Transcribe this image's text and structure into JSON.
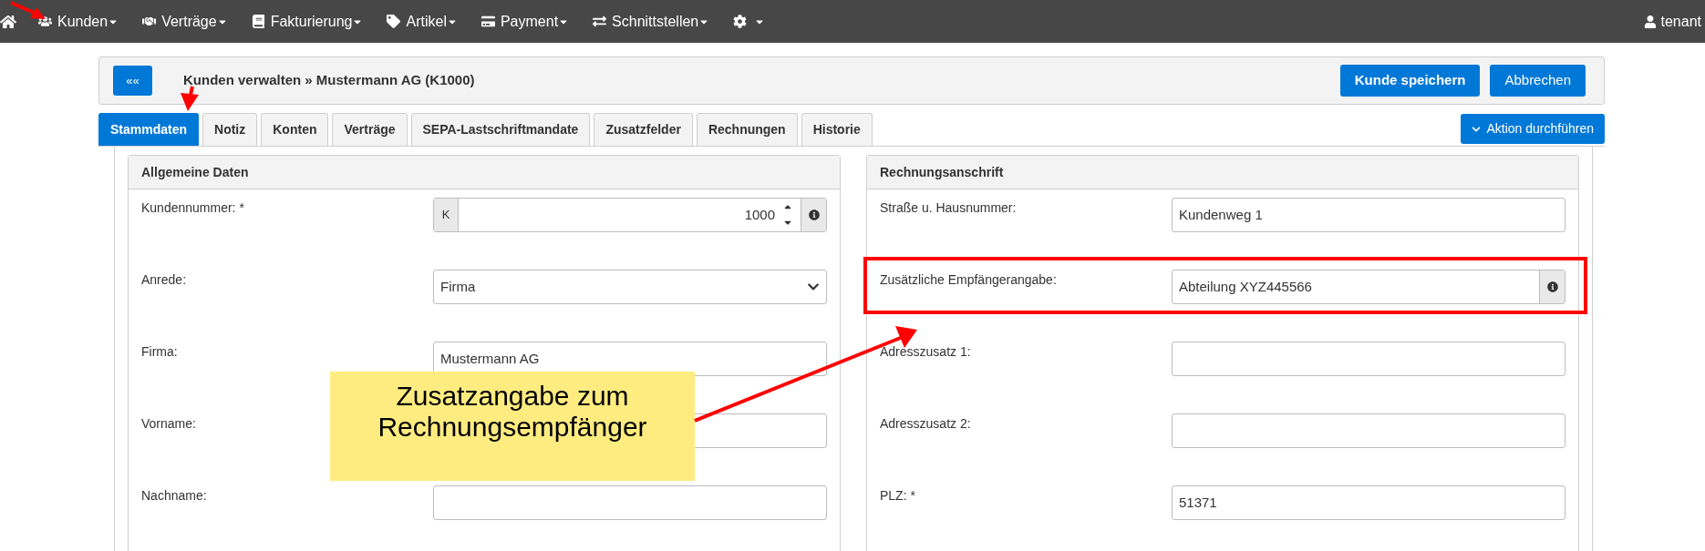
{
  "nav": {
    "items": [
      {
        "label": "Kunden"
      },
      {
        "label": "Verträge"
      },
      {
        "label": "Fakturierung"
      },
      {
        "label": "Artikel"
      },
      {
        "label": "Payment"
      },
      {
        "label": "Schnittstellen"
      }
    ],
    "user": "tenant"
  },
  "header": {
    "back": "««",
    "title": "Kunden verwalten » Mustermann AG (K1000)",
    "buttons": [
      {
        "label": "Kunde speichern",
        "primary": true
      },
      {
        "label": "Abbrechen",
        "primary": false
      }
    ]
  },
  "tabs": [
    {
      "label": "Stammdaten",
      "selected": true
    },
    {
      "label": "Notiz",
      "selected": false
    },
    {
      "label": "Konten",
      "selected": false
    },
    {
      "label": "Verträge",
      "selected": false
    },
    {
      "label": "SEPA-Lastschriftmandate",
      "selected": false
    },
    {
      "label": "Zusatzfelder",
      "selected": false
    },
    {
      "label": "Rechnungen",
      "selected": false
    },
    {
      "label": "Historie",
      "selected": false
    }
  ],
  "action_button": "Aktion durchführen",
  "cards": [
    {
      "title": "Allgemeine Daten",
      "fields": [
        {
          "label": "Kundennummer: *",
          "kind": "number",
          "prefix": "K",
          "value": "1000",
          "highlighted": false
        },
        {
          "label": "Anrede:",
          "kind": "select",
          "value": "Firma",
          "highlighted": false
        },
        {
          "label": "Firma:",
          "kind": "text",
          "value": "Mustermann AG",
          "highlighted": false
        },
        {
          "label": "Vorname:",
          "kind": "text",
          "highlighted": false
        },
        {
          "label": "Nachname:",
          "kind": "text",
          "highlighted": false
        }
      ]
    },
    {
      "title": "Rechnungsanschrift",
      "fields": [
        {
          "label": "Straße u. Hausnummer:",
          "kind": "text",
          "value": "Kundenweg 1",
          "highlighted": false
        },
        {
          "label": "Zusätzliche Empfängerangabe:",
          "kind": "info",
          "value": "Abteilung XYZ445566",
          "highlighted": true
        },
        {
          "label": "Adresszusatz 1:",
          "kind": "text",
          "highlighted": false
        },
        {
          "label": "Adresszusatz 2:",
          "kind": "text",
          "highlighted": false
        },
        {
          "label": "PLZ: *",
          "kind": "text",
          "value": "51371",
          "highlighted": false
        }
      ]
    }
  ],
  "callout": "Zusatzangabe zum Rechnungsempfänger"
}
